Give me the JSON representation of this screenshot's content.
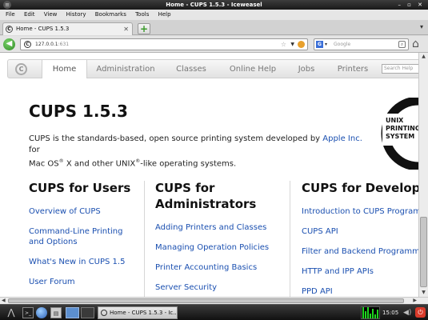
{
  "window": {
    "title": "Home - CUPS 1.5.3 - Iceweasel",
    "controls": "– ▫ ✕"
  },
  "menu": [
    "File",
    "Edit",
    "View",
    "History",
    "Bookmarks",
    "Tools",
    "Help"
  ],
  "tab": {
    "label": "Home - CUPS 1.5.3",
    "close": "✕"
  },
  "newtab_label": "+",
  "tablist_label": "▾",
  "url": {
    "host": "127.0.0.1",
    "port": ":631"
  },
  "search": {
    "placeholder": "Google",
    "engine_icon": "G"
  },
  "cups_nav": {
    "items": [
      "Home",
      "Administration",
      "Classes",
      "Online Help",
      "Jobs",
      "Printers"
    ],
    "search_placeholder": "Search Help",
    "active": "Home"
  },
  "page": {
    "title": "CUPS 1.5.3",
    "intro_1": "CUPS is the standards-based, open source printing system developed by ",
    "intro_link": "Apple Inc.",
    "intro_2": " for",
    "intro_3": "Mac OS",
    "intro_4": " X and other UNIX",
    "intro_5": "-like operating systems.",
    "registered": "®",
    "unix_logo": [
      "UNIX",
      "PRINTING",
      "SYSTEM"
    ]
  },
  "columns": [
    {
      "heading": "CUPS for Users",
      "links": [
        "Overview of CUPS",
        "Command-Line Printing and Options",
        "What's New in CUPS 1.5",
        "User Forum"
      ]
    },
    {
      "heading": "CUPS for Administrators",
      "links": [
        "Adding Printers and Classes",
        "Managing Operation Policies",
        "Printer Accounting Basics",
        "Server Security"
      ]
    },
    {
      "heading": "CUPS for Developers",
      "links": [
        "Introduction to CUPS Programming",
        "CUPS API",
        "Filter and Backend Programming",
        "HTTP and IPP APIs",
        "PPD API"
      ]
    }
  ],
  "taskbar": {
    "task_label": "Home - CUPS 1.5.3 - Ic...",
    "clock": "15:05",
    "cpu_levels": [
      0.9,
      0.6,
      0.95,
      0.4,
      0.8,
      0.3,
      0.7,
      0.5
    ]
  }
}
